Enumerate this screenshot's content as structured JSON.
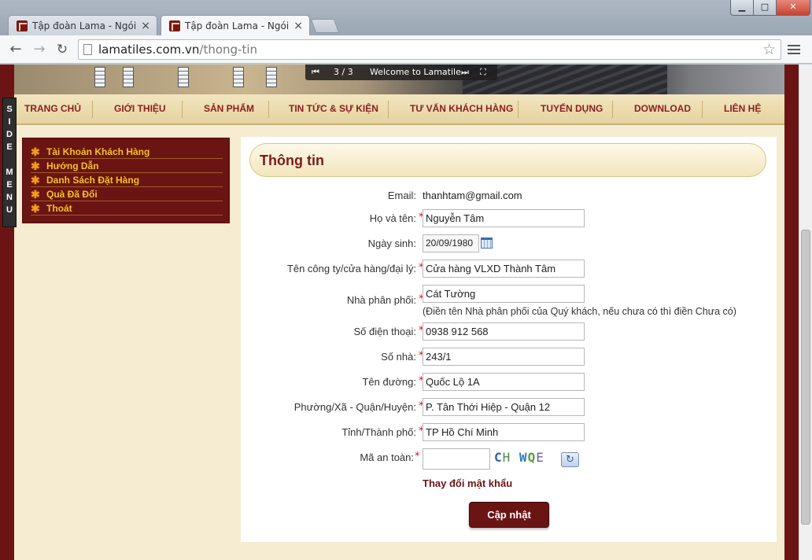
{
  "browser": {
    "tabs": [
      {
        "title": "Tập đoàn Lama - Ngói mà",
        "close": "×"
      },
      {
        "title": "Tập đoàn Lama - Ngói mà",
        "close": "×"
      }
    ],
    "url_host": "lamatiles.com.vn",
    "url_path": "/thong-tin",
    "window_controls": {
      "minimize": "▁",
      "maximize": "□",
      "close": "✕"
    }
  },
  "slider": {
    "counter": "3 / 3",
    "caption": "Welcome to Lamatile"
  },
  "nav": {
    "items": [
      "TRANG CHỦ",
      "GIỚI THIỆU",
      "SẢN PHẨM",
      "TIN TỨC & SỰ KIỆN",
      "TƯ VẤN KHÁCH HÀNG",
      "TUYỂN DỤNG",
      "DOWNLOAD",
      "LIÊN HỆ"
    ]
  },
  "side_menu": {
    "letters": [
      "S",
      "I",
      "D",
      "E",
      "",
      "M",
      "E",
      "N",
      "U"
    ]
  },
  "account_menu": {
    "items": [
      "Tài Khoản Khách Hàng",
      "Hướng Dẫn",
      "Danh Sách Đặt Hàng",
      "Quà Đã Đổi",
      "Thoát"
    ]
  },
  "form": {
    "title": "Thông tin",
    "email_label": "Email:",
    "email_value": "thanhtam@gmail.com",
    "name_label": "Họ và tên:",
    "name_value": "Nguyễn Tâm",
    "dob_label": "Ngày sinh:",
    "dob_value": "20/09/1980",
    "company_label": "Tên công ty/cửa hàng/đại lý:",
    "company_value": "Cửa hàng VLXD Thành Tâm",
    "distributor_label": "Nhà phân phối:",
    "distributor_value": "Cát Tường",
    "distributor_hint": "(Điền tên Nhà phân phối của Quý khách, nếu chưa có thì điền Chưa có)",
    "phone_label": "Số điện thoại:",
    "phone_value": "0938 912 568",
    "house_label": "Số nhà:",
    "house_value": "243/1",
    "street_label": "Tên đường:",
    "street_value": "Quốc Lộ 1A",
    "ward_label": "Phường/Xã - Quận/Huyện:",
    "ward_value": "P. Tân Thới Hiệp - Quận  12",
    "city_label": "Tỉnh/Thành phố:",
    "city_value": "TP Hồ Chí Minh",
    "captcha_label": "Mã an toàn:",
    "captcha_value": "",
    "captcha_chars": [
      "C",
      "H",
      "W",
      "Q",
      "E"
    ],
    "required_mark": "*",
    "change_password": "Thay đổi mật khẩu",
    "submit": "Cập nhật"
  },
  "colors": {
    "brand_maroon": "#6b1414",
    "nav_text": "#8a1f1f",
    "menu_gold": "#f4c21f",
    "required": "#dd1111"
  }
}
